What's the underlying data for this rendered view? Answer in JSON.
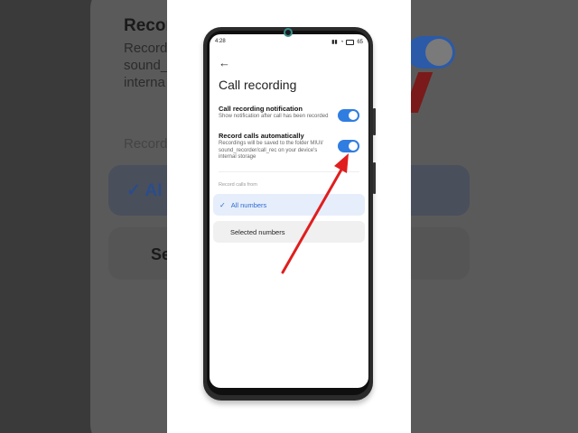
{
  "status_bar": {
    "time": "4:28",
    "battery": "65"
  },
  "page": {
    "title": "Call recording"
  },
  "settings": [
    {
      "title": "Call recording notification",
      "description": "Show notification after call has been recorded",
      "enabled": true
    },
    {
      "title": "Record calls automatically",
      "description": "Recordings will be saved to the folder MIUI/ sound_recorder/call_rec on your device's internal storage",
      "enabled": true
    }
  ],
  "record_from": {
    "label": "Record calls from",
    "options": [
      {
        "label": "All numbers",
        "selected": true
      },
      {
        "label": "Selected numbers",
        "selected": false
      }
    ]
  },
  "background_zoom": {
    "title": "Record",
    "desc_lines": [
      "Record",
      "sound_",
      "interna"
    ],
    "section": "Record",
    "all": "Al",
    "sel": "Se"
  },
  "colors": {
    "accent": "#2f7de1",
    "annotation_arrow": "#e01e1e"
  }
}
